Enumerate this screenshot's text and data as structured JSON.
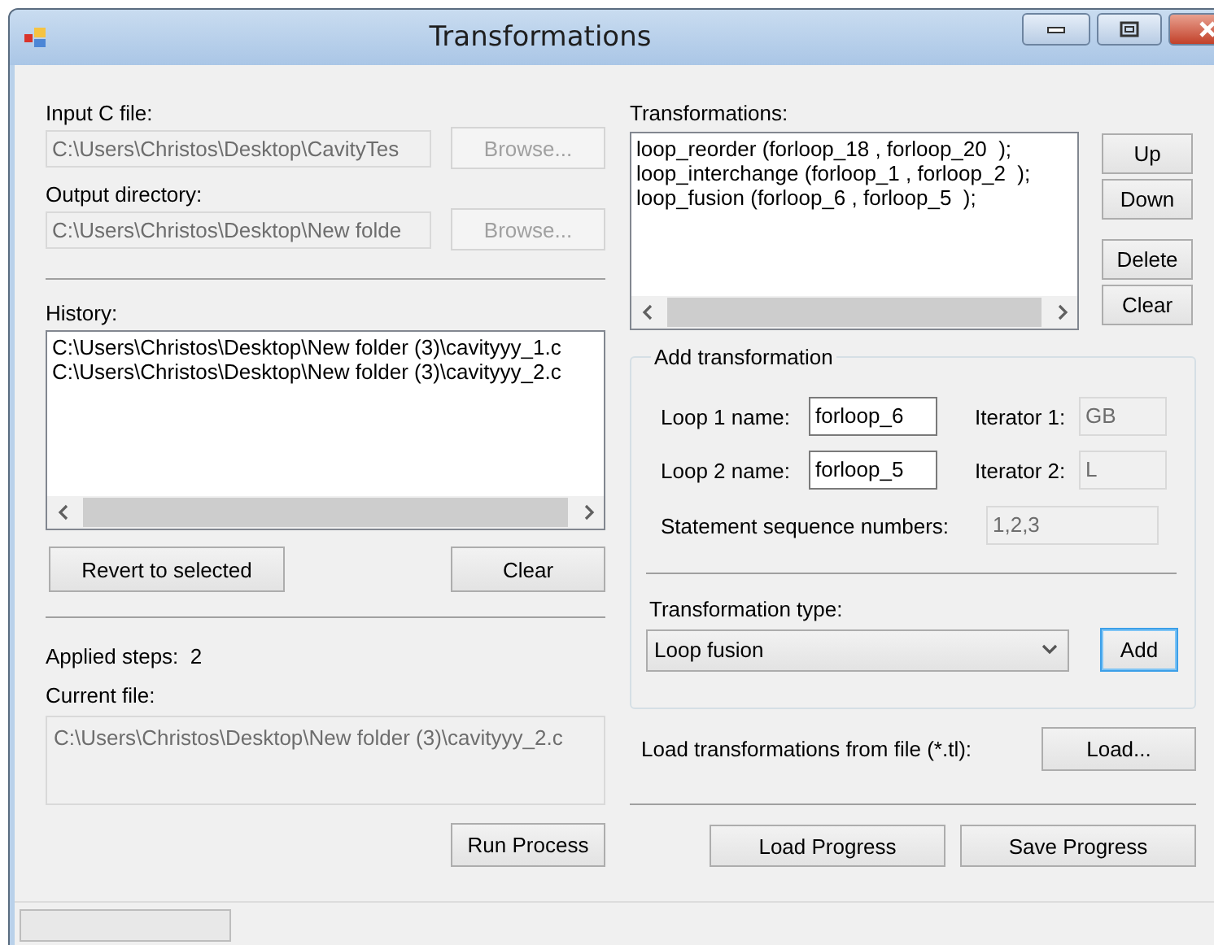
{
  "window": {
    "title": "Transformations"
  },
  "input_file": {
    "label": "Input C file:",
    "value": "C:\\Users\\Christos\\Desktop\\CavityTes",
    "disabled": true,
    "button": {
      "label": "Browse...",
      "disabled": true
    }
  },
  "output_directory": {
    "label": "Output directory:",
    "value": "C:\\Users\\Christos\\Desktop\\New folde",
    "disabled": true,
    "button": {
      "label": "Browse...",
      "disabled": true
    }
  },
  "history": {
    "label": "History:",
    "items": [
      {
        "text": "C:\\Users\\Christos\\Desktop\\New folder (3)\\cavityyy_1.c",
        "selected": false
      },
      {
        "text": "C:\\Users\\Christos\\Desktop\\New folder (3)\\cavityyy_2.c",
        "selected": false
      }
    ],
    "buttons": [
      "Revert to selected",
      "Clear"
    ]
  },
  "applied_steps": {
    "label": "Applied steps:",
    "value": "2"
  },
  "current_file": {
    "label": "Current file:",
    "value": "C:\\Users\\Christos\\Desktop\\New folder (3)\\cavityyy_2.c",
    "disabled": true
  },
  "run_button": "Run Process",
  "transformations": {
    "label": "Transformations:",
    "items": [
      {
        "text": "loop_reorder (forloop_18 , forloop_20  );",
        "selected": false
      },
      {
        "text": "loop_interchange (forloop_1 , forloop_2  );",
        "selected": false
      },
      {
        "text": "loop_fusion (forloop_6 , forloop_5  );",
        "selected": false
      }
    ],
    "buttons": [
      "Up",
      "Down",
      "Delete",
      "Clear"
    ]
  },
  "add_transformation": {
    "title": "Add transformation",
    "loop1": {
      "label": "Loop 1 name:",
      "value": "forloop_6",
      "disabled": false
    },
    "iterator1": {
      "label": "Iterator 1:",
      "value": "GB",
      "disabled": true
    },
    "loop2": {
      "label": "Loop 2 name:",
      "value": "forloop_5",
      "disabled": false
    },
    "iterator2": {
      "label": "Iterator 2:",
      "value": "L",
      "disabled": true
    },
    "statement_sequence": {
      "label": "Statement sequence numbers:",
      "value": "1,2,3",
      "disabled": true
    },
    "type": {
      "label": "Transformation type:",
      "value": "Loop fusion"
    },
    "add_button": {
      "label": "Add",
      "focused": true
    }
  },
  "load_file": {
    "label": "Load transformations from file (*.tl):",
    "button": "Load..."
  },
  "progress_buttons": [
    "Load Progress",
    "Save Progress"
  ]
}
